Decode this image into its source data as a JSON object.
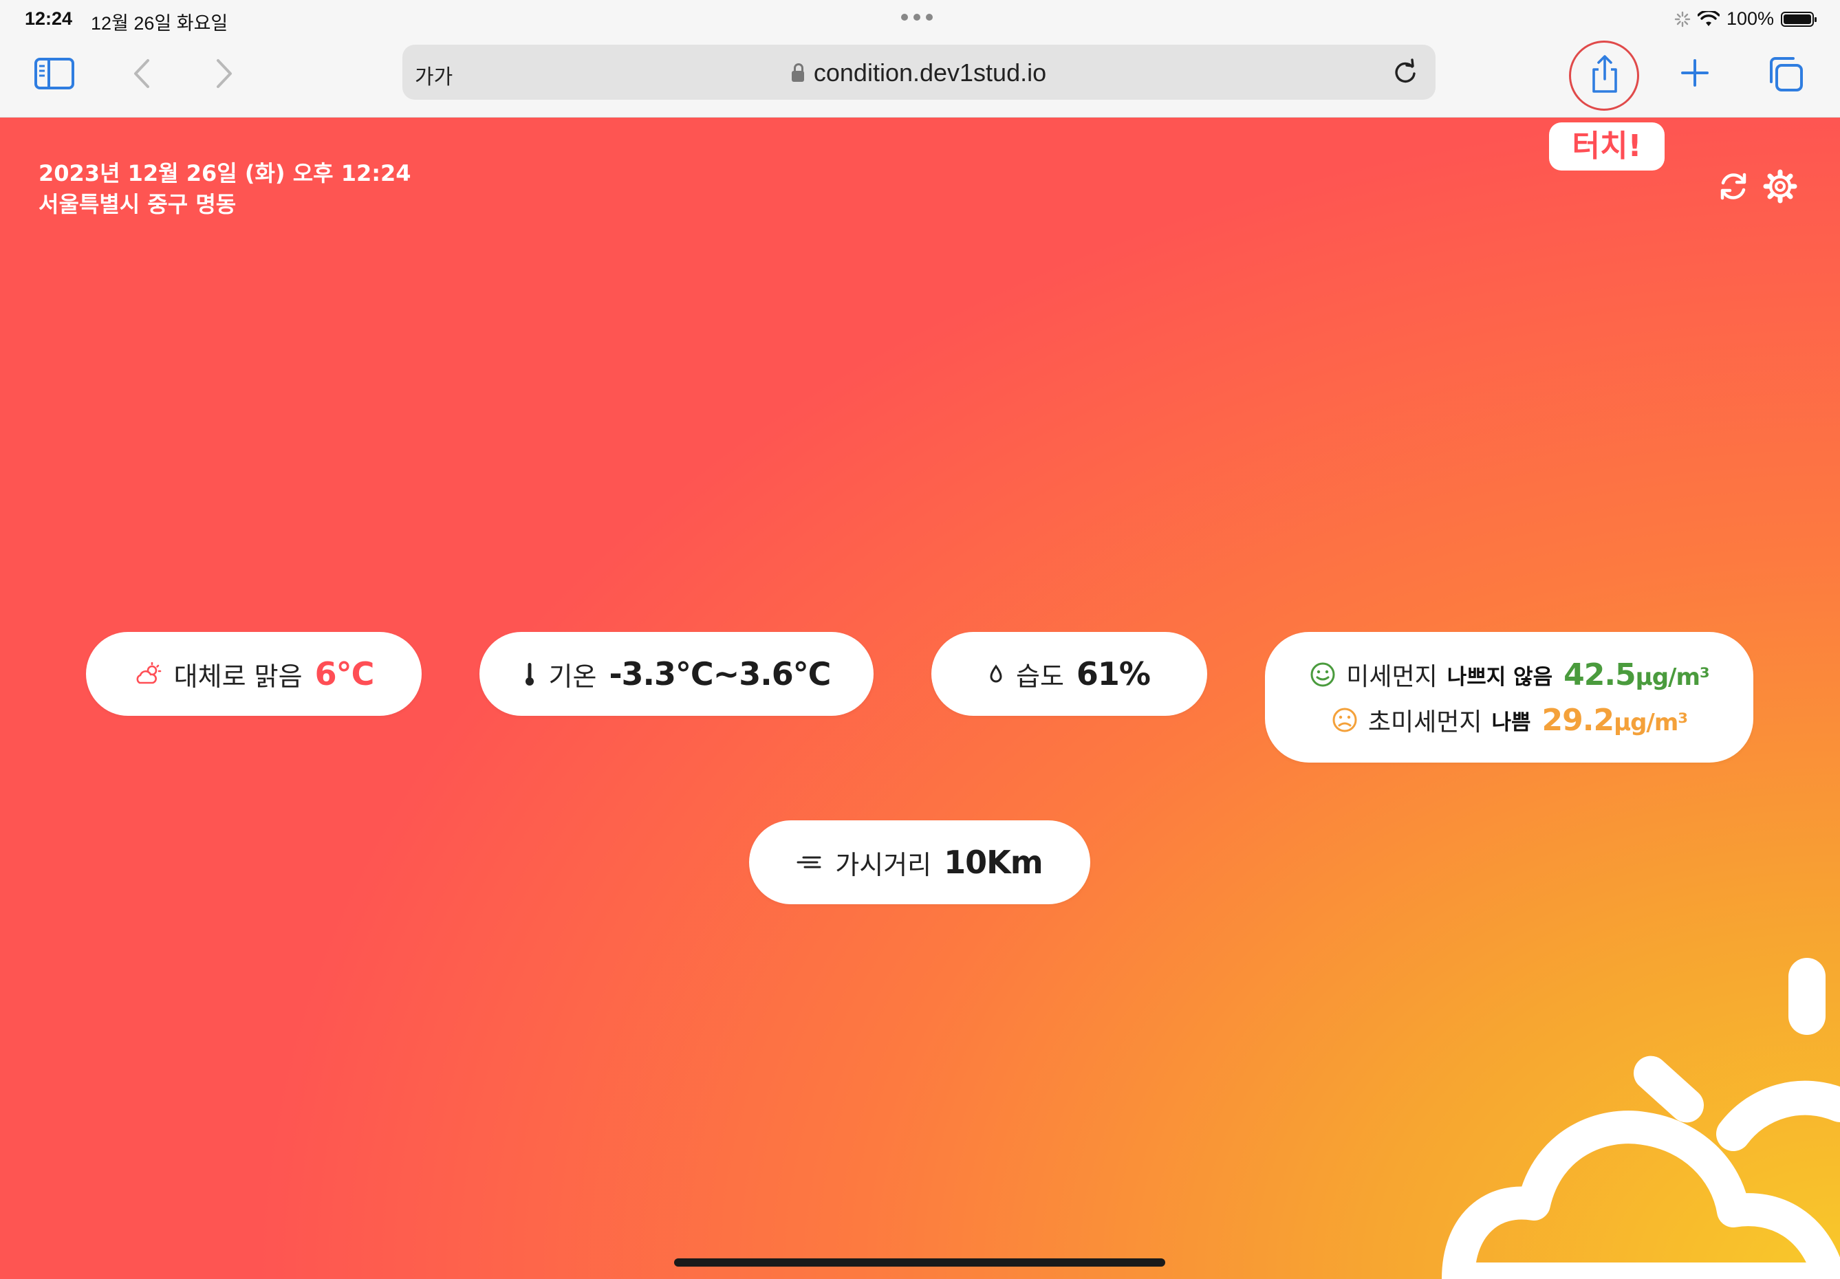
{
  "status_bar": {
    "time": "12:24",
    "date": "12월 26일 화요일",
    "battery": "100%"
  },
  "browser": {
    "text_size_button": "가가",
    "url": "condition.dev1stud.io"
  },
  "overlay": {
    "touch_label": "터치!"
  },
  "header": {
    "datetime": "2023년 12월 26일 (화) 오후 12:24",
    "location": "서울특별시 중구 명동"
  },
  "weather": {
    "sky": {
      "label": "대체로 맑음",
      "value": "6°C"
    },
    "temperature": {
      "label": "기온",
      "value": "-3.3℃~3.6℃"
    },
    "humidity": {
      "label": "습도",
      "value": "61%"
    },
    "fine_dust": {
      "label": "미세먼지",
      "grade": "나쁘지 않음",
      "value": "42.5",
      "unit": "μg/m³"
    },
    "ultrafine_dust": {
      "label": "초미세먼지",
      "grade": "나쁨",
      "value": "29.2",
      "unit": "μg/m³"
    },
    "visibility": {
      "label": "가시거리",
      "value": "10Km"
    }
  },
  "colors": {
    "accent_red": "#ff4e55",
    "good_green": "#4a9b3d",
    "bad_orange": "#f4a13a",
    "safari_blue": "#2f7de0"
  },
  "icons": [
    "sidebar-icon",
    "back-icon",
    "forward-icon",
    "lock-icon",
    "reload-icon",
    "share-icon",
    "new-tab-icon",
    "tabs-icon",
    "refresh-icon",
    "settings-icon",
    "cloud-sun-icon",
    "thermometer-icon",
    "drop-icon",
    "smile-icon",
    "frown-icon",
    "wind-icon",
    "sun-cloud-illustration"
  ]
}
